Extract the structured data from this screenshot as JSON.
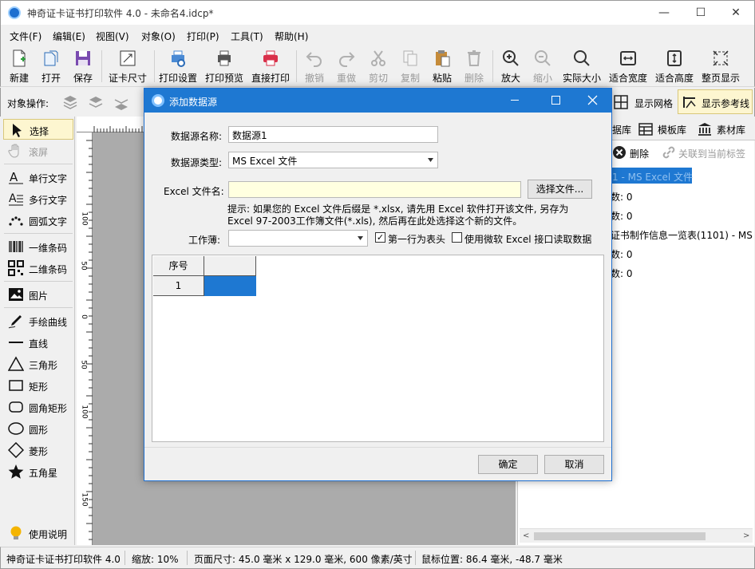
{
  "window": {
    "title": "神奇证卡证书打印软件 4.0 - 未命名4.idcp*",
    "minimize": "—",
    "maximize": "☐",
    "close": "✕"
  },
  "menus": [
    "文件(F)",
    "编辑(E)",
    "视图(V)",
    "对象(O)",
    "打印(P)",
    "工具(T)",
    "帮助(H)"
  ],
  "toolbar": {
    "new": "新建",
    "open": "打开",
    "save": "保存",
    "card_size": "证卡尺寸",
    "print_setup": "打印设置",
    "print_preview": "打印预览",
    "direct_print": "直接打印",
    "undo": "撤销",
    "redo": "重做",
    "cut": "剪切",
    "copy": "复制",
    "paste": "粘贴",
    "delete": "删除",
    "zoom_in": "放大",
    "zoom_out": "缩小",
    "actual_size": "实际大小",
    "fit_width": "适合宽度",
    "fit_height": "适合高度",
    "full_page": "整页显示"
  },
  "objbar": {
    "label": "对象操作:",
    "show_grid": "显示网格",
    "show_guides": "显示参考线"
  },
  "tools": [
    "选择",
    "滚屏",
    "单行文字",
    "多行文字",
    "圆弧文字",
    "一维条码",
    "二维条码",
    "图片",
    "手绘曲线",
    "直线",
    "三角形",
    "矩形",
    "圆角矩形",
    "圆形",
    "菱形",
    "五角星",
    "使用说明"
  ],
  "ruler": {
    "left_marks": [
      "100",
      "50",
      "0",
      "50",
      "100",
      "150"
    ]
  },
  "right_panel": {
    "tabs": [
      "据库",
      "模板库",
      "素材库"
    ],
    "delete_label": "删除",
    "link_label": "关联到当前标签",
    "tree": [
      "1 - MS Excel 文件",
      "数: 0",
      "数: 0",
      "证书制作信息一览表(1101) - MS E",
      "数: 0",
      "数: 0"
    ]
  },
  "status": {
    "app": "神奇证卡证书打印软件 4.0",
    "zoom": "缩放: 10%",
    "page_size": "页面尺寸: 45.0 毫米 x 129.0 毫米, 600 像素/英寸",
    "mouse": "鼠标位置: 86.4 毫米, -48.7 毫米"
  },
  "dialog": {
    "title": "添加数据源",
    "name_label": "数据源名称:",
    "name_value": "数据源1",
    "type_label": "数据源类型:",
    "type_value": "MS Excel 文件",
    "file_label": "Excel 文件名:",
    "file_value": "",
    "browse_button": "选择文件...",
    "hint_line1": "提示: 如果您的 Excel 文件后缀是 *.xlsx, 请先用 Excel 软件打开该文件, 另存为",
    "hint_line2": "Excel 97-2003工作簿文件(*.xls), 然后再在此处选择这个新的文件。",
    "sheet_label": "工作薄:",
    "sheet_value": "",
    "first_row_header": "第一行为表头",
    "first_row_checked": true,
    "use_ms_interface": "使用微软 Excel 接口读取数据",
    "use_ms_checked": false,
    "grid_header": [
      "序号",
      ""
    ],
    "grid_rows": [
      [
        "1",
        ""
      ]
    ],
    "ok": "确定",
    "cancel": "取消"
  }
}
